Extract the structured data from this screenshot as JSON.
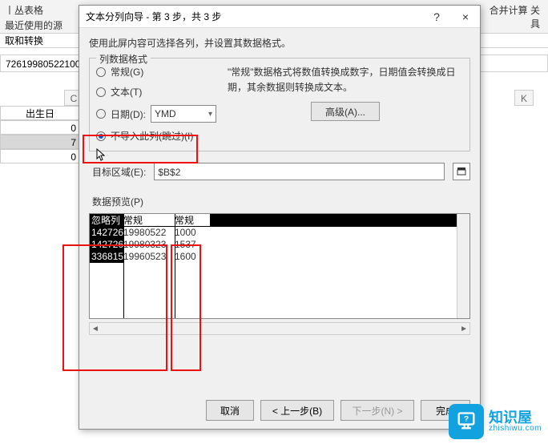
{
  "bg": {
    "ribbon_lines": [
      "丨丛表格",
      "  最近使用的源",
      "取和转换"
    ],
    "ribbon_right": "合并计算   关",
    "ribbon_right2": "具",
    "formula_value": "72619980522100",
    "colC": "C",
    "colK": "K",
    "cell_head": "出生日",
    "cells": [
      "0",
      "7",
      "0"
    ]
  },
  "dialog": {
    "title": "文本分列向导 - 第 3 步，共 3 步",
    "help": "?",
    "close": "×",
    "description": "使用此屏内容可选择各列，并设置其数据格式。",
    "group_legend": "列数据格式",
    "radios": {
      "general": "常规(G)",
      "text": "文本(T)",
      "date": "日期(D):",
      "skip": "不导入此列(跳过)(I)"
    },
    "date_format": "YMD",
    "right_text": "\"常规\"数据格式将数值转换成数字，日期值会转换成日期，其余数据则转换成文本。",
    "advanced": "高级(A)...",
    "target_label": "目标区域(E):",
    "target_value": "$B$2",
    "preview_label": "数据预览(P)",
    "preview": {
      "headers": [
        "忽略列",
        "常规",
        "常规"
      ],
      "rows": [
        [
          "142726",
          "19980522",
          "1000"
        ],
        [
          "142726",
          "19980323",
          "1537"
        ],
        [
          "336815",
          "19960523",
          "1600"
        ]
      ]
    },
    "buttons": {
      "cancel": "取消",
      "back": "< 上一步(B)",
      "next": "下一步(N) >",
      "finish": "完成"
    }
  },
  "watermark": {
    "name": "知识屋",
    "url": "zhishiwu.com"
  }
}
